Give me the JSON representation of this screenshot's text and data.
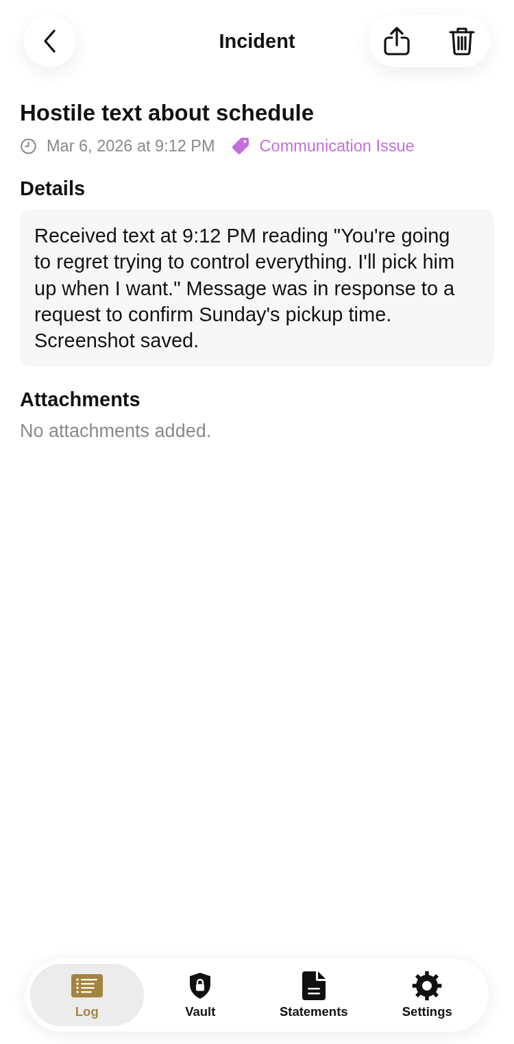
{
  "header": {
    "title": "Incident"
  },
  "incident": {
    "title": "Hostile text about schedule",
    "timestamp": "Mar 6, 2026 at 9:12 PM",
    "category": "Communication Issue"
  },
  "details": {
    "heading": "Details",
    "text": "Received text at 9:12 PM reading \"You're going to regret trying to control everything. I'll pick him up when I want.\" Message was in response to a request to confirm Sunday's pickup time. Screenshot saved."
  },
  "attachments": {
    "heading": "Attachments",
    "empty_text": "No attachments added."
  },
  "tab_bar": {
    "tabs": [
      {
        "label": "Log",
        "selected": true
      },
      {
        "label": "Vault",
        "selected": false
      },
      {
        "label": "Statements",
        "selected": false
      },
      {
        "label": "Settings",
        "selected": false
      }
    ]
  }
}
